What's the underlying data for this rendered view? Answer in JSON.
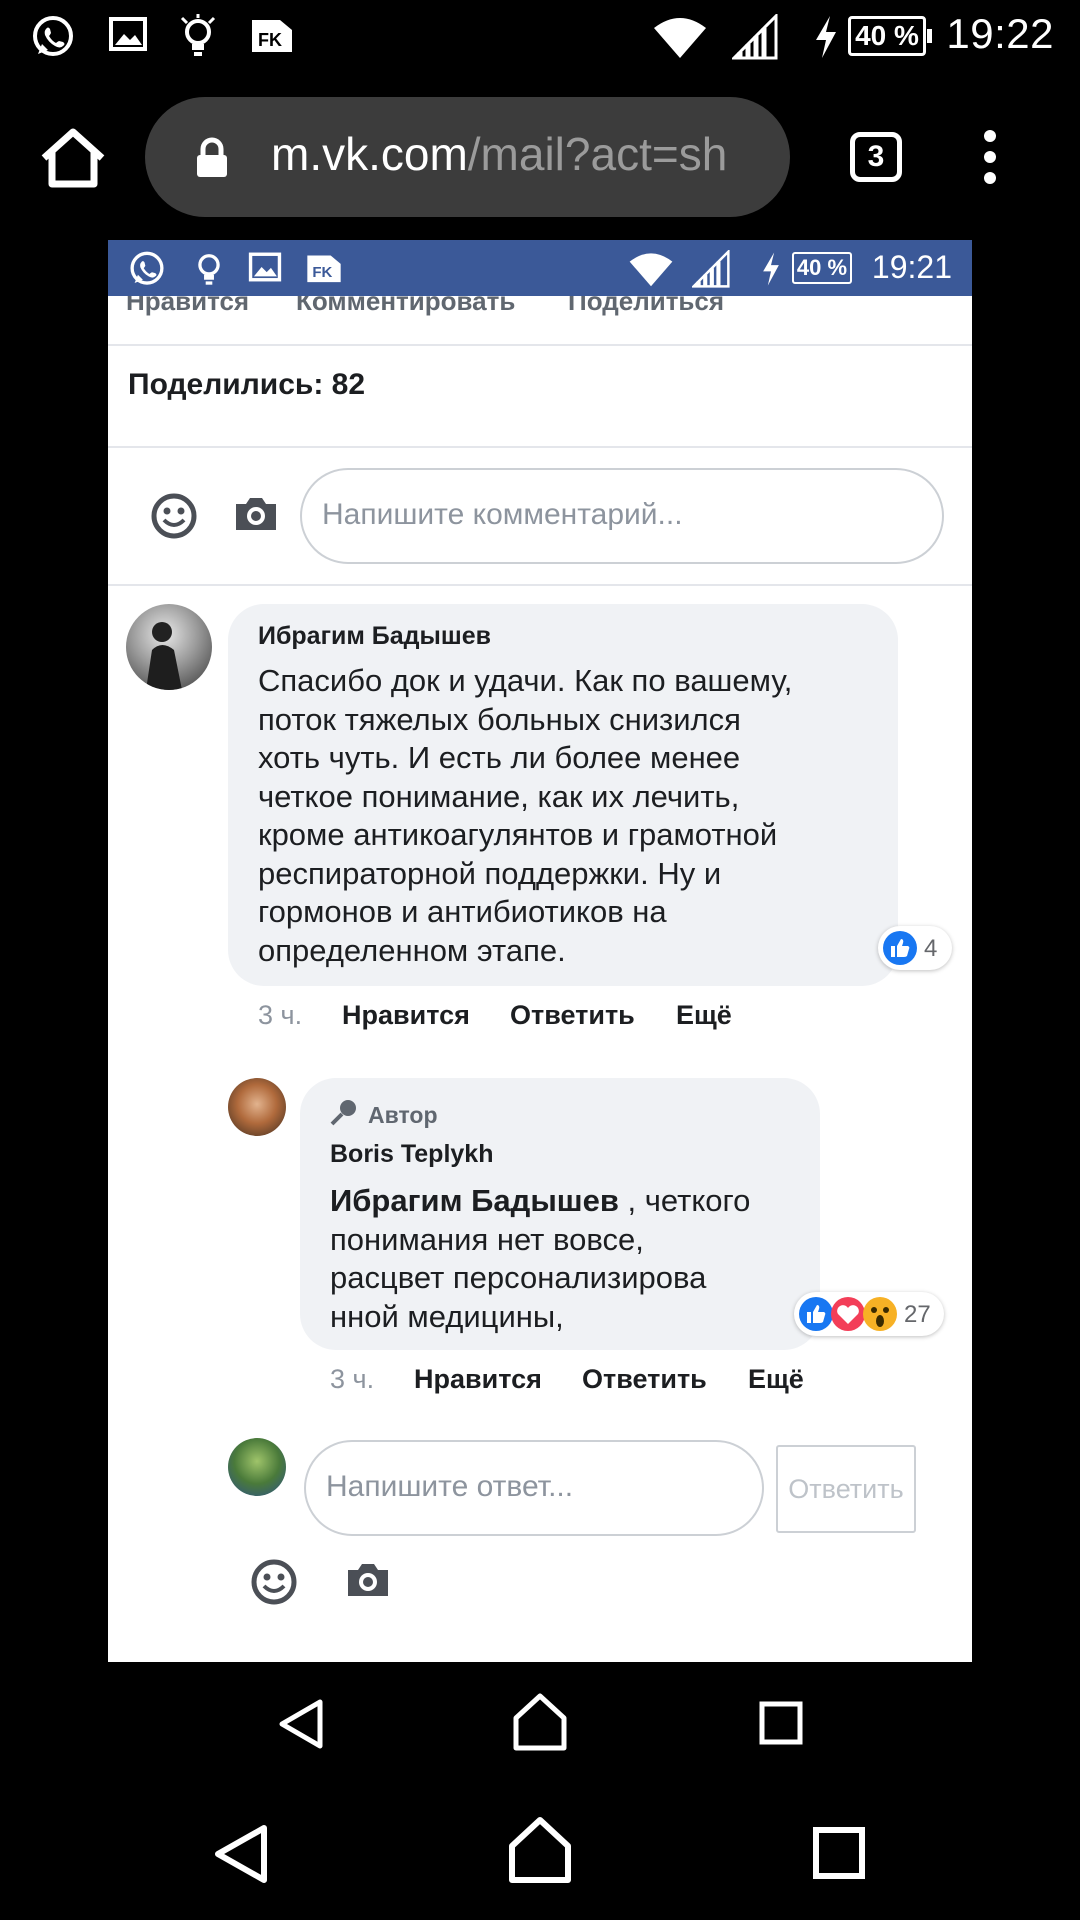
{
  "status_bar": {
    "time": "19:22",
    "battery": "40 %",
    "icons": [
      "whatsapp-icon",
      "gallery-icon",
      "lightbulb-icon",
      "fk-icon",
      "wifi-icon",
      "signal-icon",
      "charging-icon"
    ]
  },
  "browser": {
    "url_host": "m.vk.com",
    "url_path": "/mail?act=sh",
    "tab_count": "3"
  },
  "inner_status_bar": {
    "time": "19:21",
    "battery": "40 %"
  },
  "post_actions": {
    "like": "Нравится",
    "comment": "Комментировать",
    "share": "Поделиться"
  },
  "shares_text": "Поделились: 82",
  "comment_input": {
    "placeholder": "Напишите комментарий..."
  },
  "comments": [
    {
      "author": "Ибрагим Бадышев",
      "lines": [
        "Спасибо док и удачи. Как по вашему,",
        "поток тяжелых больных снизился",
        "хоть чуть. И есть ли более менее",
        "четкое понимание, как их лечить,",
        "кроме антикоагулянтов и грамотной",
        "респираторной поддержки. Ну и",
        "гормонов и антибиотиков на",
        "определенном этапе."
      ],
      "reactions": "4",
      "time": "3 ч.",
      "like": "Нравится",
      "reply": "Ответить",
      "more": "Ещё"
    }
  ],
  "reply": {
    "badge": "Автор",
    "author": "Boris Teplykh",
    "mention": "Ибрагим Бадышев",
    "line1_rest": " , четкого",
    "lines": [
      "понимания нет вовсе,",
      "расцвет персонализирова",
      "нной медицины,"
    ],
    "reactions": "27",
    "time": "3 ч.",
    "like": "Нравится",
    "reply": "Ответить",
    "more": "Ещё"
  },
  "reply_input": {
    "placeholder": "Напишите ответ...",
    "button": "Ответить"
  },
  "colors": {
    "facebook_blue": "#3b5998",
    "like_blue": "#1877f2",
    "bubble": "#f0f2f5"
  }
}
